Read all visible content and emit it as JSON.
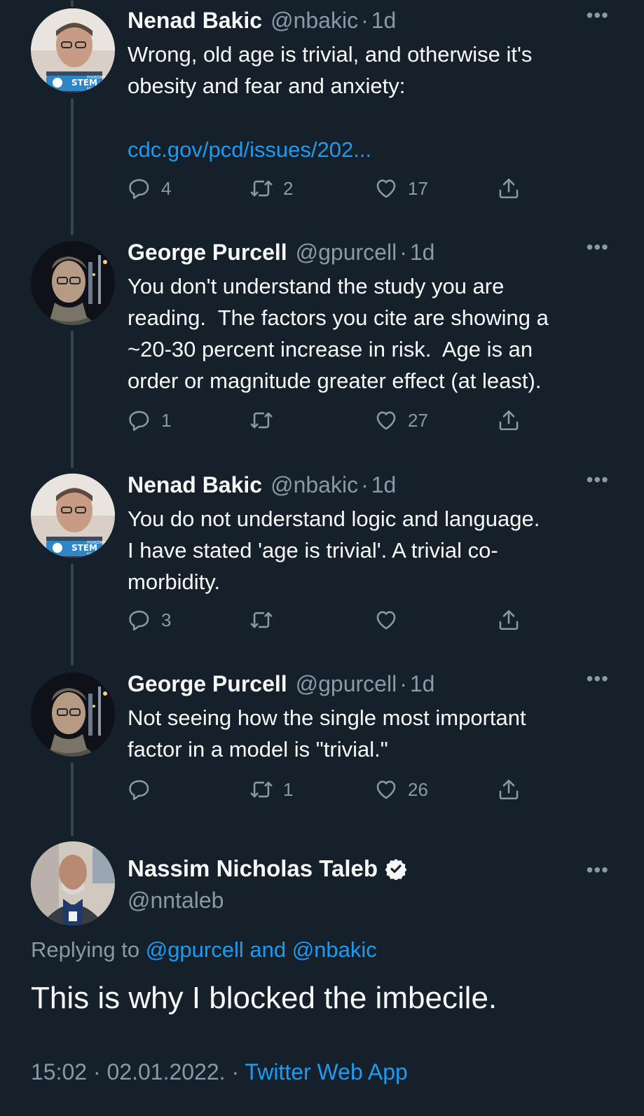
{
  "tweets": [
    {
      "name": "Nenad Bakic",
      "handle": "@nbakic",
      "time": "1d",
      "text": "Wrong, old age is trivial, and otherwise it's\nobesity and fear and anxiety:",
      "link": "cdc.gov/pcd/issues/202...",
      "replies": "4",
      "retweets": "2",
      "likes": "17",
      "avatar_badge": "STEM",
      "avatar_badge_small_top": "PODRŽAVAM",
      "avatar_badge_small_bottom": "REVOLUCIJU"
    },
    {
      "name": "George Purcell",
      "handle": "@gpurcell",
      "time": "1d",
      "text": "You don't understand the study you are\nreading.  The factors you cite are showing a\n~20-30 percent increase in risk.  Age is an\norder or magnitude greater effect (at least).",
      "replies": "1",
      "retweets": "",
      "likes": "27"
    },
    {
      "name": "Nenad Bakic",
      "handle": "@nbakic",
      "time": "1d",
      "text": "You do not understand logic and language.\nI have stated 'age is trivial'. A trivial co-\nmorbidity.",
      "replies": "3",
      "retweets": "",
      "likes": "",
      "avatar_badge": "STEM",
      "avatar_badge_small_top": "PODRŽAVAM",
      "avatar_badge_small_bottom": "REVOLUCIJU"
    },
    {
      "name": "George Purcell",
      "handle": "@gpurcell",
      "time": "1d",
      "text": "Not seeing how the single most important\nfactor in a model is \"trivial.\"",
      "replies": "",
      "retweets": "1",
      "likes": "26"
    }
  ],
  "main": {
    "name": "Nassim Nicholas Taleb",
    "handle": "@nntaleb",
    "replying_prefix": "Replying to ",
    "replying_mentions": "@gpurcell and @nbakic",
    "text": "This is why I blocked the imbecile.",
    "timestamp": "15:02 · 02.01.2022. · ",
    "app": "Twitter Web App"
  },
  "ui": {
    "separator": "·",
    "more": "•••"
  },
  "colors": {
    "background": "#15202b",
    "text": "#f7f9f9",
    "muted": "#8b98a5",
    "accent": "#1d9bf0",
    "thread_line": "#38444d"
  },
  "icons": [
    "reply-icon",
    "retweet-icon",
    "like-icon",
    "share-icon",
    "more-icon",
    "verified-badge-icon"
  ]
}
